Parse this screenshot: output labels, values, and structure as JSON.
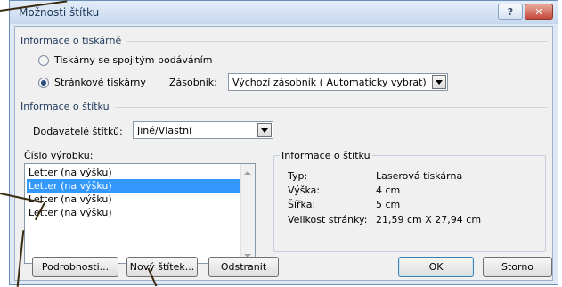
{
  "window": {
    "title": "Možnosti štítku",
    "help_label": "?",
    "close_label": "✕"
  },
  "printer_info": {
    "section_title": "Informace o tiskárně",
    "continuous_label": "Tiskárny se spojitým podáváním",
    "page_label": "Stránkové tiskárny",
    "selected": "page",
    "tray_label": "Zásobník:",
    "tray_value": "Výchozí zásobník ( Automaticky vybrat)"
  },
  "label_info": {
    "section_title": "Informace o štítku",
    "vendors_label": "Dodavatelé štítků:",
    "vendors_value": "Jiné/Vlastní"
  },
  "product": {
    "label": "Číslo výrobku:",
    "items": [
      "Letter (na výšku)",
      "Letter (na výšku)",
      "Letter (na výšku)",
      "Letter (na výšku)"
    ],
    "selected_index": 1
  },
  "details": {
    "title": "Informace o štítku",
    "rows": [
      {
        "key": "Typ:",
        "value": "Laserová tiskárna"
      },
      {
        "key": "Výška:",
        "value": "4 cm"
      },
      {
        "key": "Šířka:",
        "value": "5 cm"
      },
      {
        "key": "Velikost stránky:",
        "value": "21,59 cm X 27,94 cm"
      }
    ]
  },
  "buttons": {
    "details": "Podrobnosti...",
    "new_label": "Nový štítek...",
    "delete": "Odstranit",
    "ok": "OK",
    "cancel": "Storno"
  }
}
